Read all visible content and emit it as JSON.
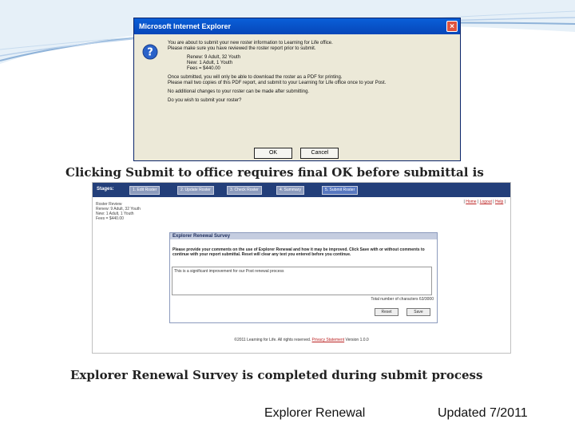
{
  "dialog": {
    "title": "Microsoft Internet Explorer",
    "close_glyph": "×",
    "line1": "You are about to submit your new roster information to Learning for Life office.",
    "line2": "Please make sure you have reviewed the roster report prior to submit.",
    "renew": "Renew: 9 Adult, 32 Youth",
    "new": "New: 1 Adult, 1 Youth",
    "fees": "Fees = $440.00",
    "line3": "Once submitted, you will only be able to download the roster as a PDF for printing.",
    "line4": "Please mail two copies of this PDF report, and submit to your Learning for Life office once to your Post.",
    "line5": "No additional changes to your roster can be made after submitting.",
    "line6": "Do you wish to submit your roster?",
    "ok_label": "OK",
    "cancel_label": "Cancel"
  },
  "caption1": "Clicking Submit to office requires final OK before submittal is",
  "app": {
    "stages_label": "Stages:",
    "tabs": [
      "1. Edit Roster",
      "2. Update Roster",
      "3. Check Roster",
      "4. Summary",
      "5. Submit Roster"
    ],
    "left_lines": [
      "Roster Review",
      "Renew: 9 Adult, 32 Youth",
      "New: 1 Adult, 1 Youth",
      "Fees = $440.00"
    ],
    "links": [
      "Home",
      "Logout",
      "Help"
    ],
    "survey_title": "Explorer Renewal Survey",
    "survey_instructions": "Please provide your comments on the use of Explorer Renewal and how it may be improved. Click Save with or without comments to continue with your report submittal. Reset will clear any text you entered before you continue.",
    "survey_text": "This is a significant improvement for our Post renewal process",
    "char_count": "Total number of characters 63/3000",
    "reset_label": "Reset",
    "save_label": "Save",
    "footer_text": "©2011 Learning for Life. All rights reserved.",
    "footer_link": "Privacy Statement",
    "footer_version": "Version 1.0.0"
  },
  "caption2": "Explorer Renewal Survey is completed during submit process",
  "footer": {
    "left": "Explorer Renewal",
    "right": "Updated 7/2011"
  }
}
